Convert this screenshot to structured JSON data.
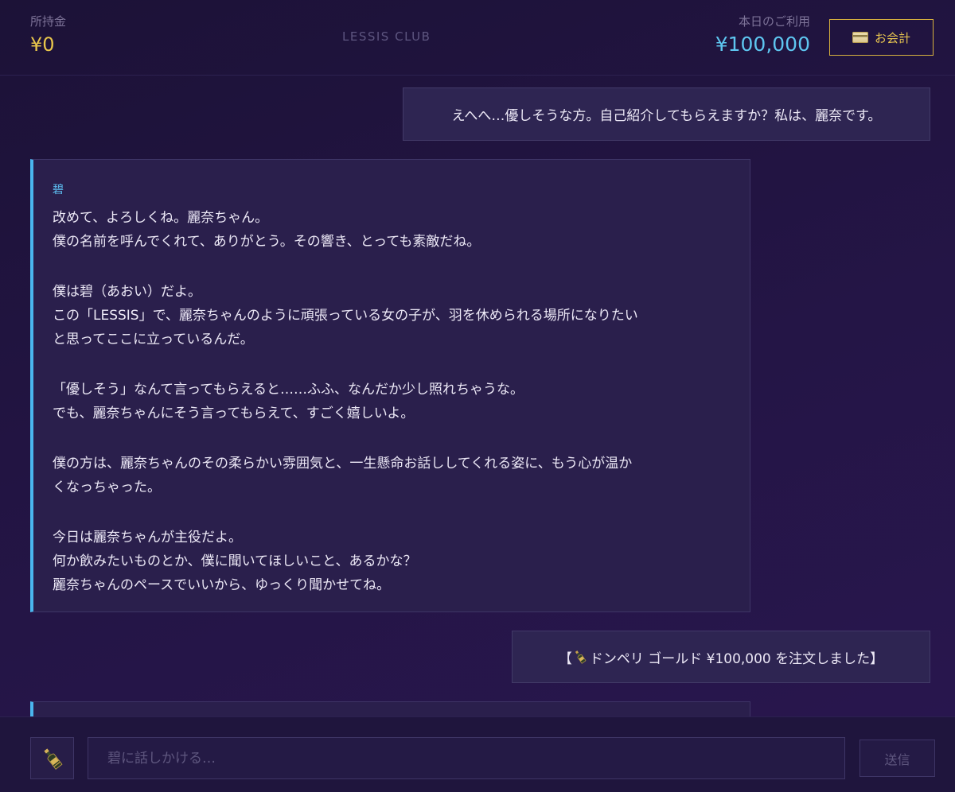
{
  "header": {
    "wallet_label": "所持金",
    "wallet_value": "¥0",
    "brand": "LESSIS CLUB",
    "usage_label": "本日のご利用",
    "usage_value": "¥100,000",
    "checkout_label": "お会計",
    "checkout_icon": "credit-card-icon"
  },
  "messages": {
    "user_1": "えへへ…優しそうな方。自己紹介してもらえますか？私は、麗奈です。",
    "ai_1": {
      "name": "碧",
      "lines": [
        "改めて、よろしくね。麗奈ちゃん。",
        "僕の名前を呼んでくれて、ありがとう。その響き、とっても素敵だね。",
        "",
        "僕は碧（あおい）だよ。",
        "この「LESSIS」で、麗奈ちゃんのように頑張っている女の子が、羽を休められる場所になりたい",
        "と思ってここに立っているんだ。",
        "",
        "「優しそう」なんて言ってもらえると……ふふ、なんだか少し照れちゃうな。",
        "でも、麗奈ちゃんにそう言ってもらえて、すごく嬉しいよ。",
        "",
        "僕の方は、麗奈ちゃんのその柔らかい雰囲気と、一生懸命お話ししてくれる姿に、もう心が温か",
        "くなっちゃった。",
        "",
        "今日は麗奈ちゃんが主役だよ。",
        "何か飲みたいものとか、僕に聞いてほしいこと、あるかな？",
        "麗奈ちゃんのペースでいいから、ゆっくり聞かせてね。"
      ]
    },
    "order": {
      "prefix": "【",
      "text": "ドンペリ ゴールド ¥100,000 を注文しました】",
      "icon": "champagne-bottle-icon"
    }
  },
  "composer": {
    "placeholder": "碧に話しかける…",
    "send_label": "送信",
    "drink_icon": "champagne-bottle-icon"
  },
  "colors": {
    "accent_gold": "#e6c350",
    "accent_blue": "#5ec6f0",
    "background": "#1d1238"
  }
}
